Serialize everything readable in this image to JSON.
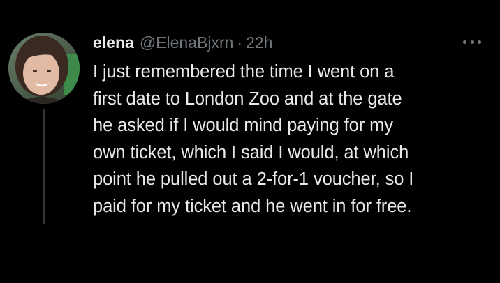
{
  "tweet": {
    "display_name": "elena",
    "handle": "@ElenaBjxrn",
    "separator": "·",
    "time": "22h",
    "more_icon": "more-horizontal-icon",
    "avatar_icon": "avatar",
    "text_lines": [
      "I just remembered the time I went on a",
      "first date to London Zoo and at the gate",
      "he asked if I would mind paying for my",
      "own ticket, which I said I would, at which",
      "point he pulled out a 2-for-1 voucher, so I",
      "paid for my ticket and he went in for free."
    ]
  },
  "colors": {
    "background": "#000000",
    "primary_text": "#e7e9ea",
    "secondary_text": "#71767b",
    "thread_line": "#333639"
  }
}
